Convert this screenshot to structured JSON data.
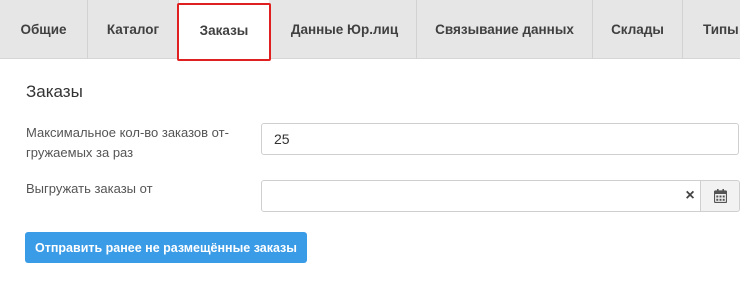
{
  "tabs": [
    {
      "label": "Общие"
    },
    {
      "label": "Каталог"
    },
    {
      "label": "Заказы",
      "active": true
    },
    {
      "label": "Данные Юр.лиц"
    },
    {
      "label": "Связывание данных"
    },
    {
      "label": "Склады"
    },
    {
      "label": "Типы"
    }
  ],
  "section": {
    "title": "Заказы"
  },
  "fields": {
    "max_orders": {
      "label": "Максимальное кол-во заказов от-гружаемых за раз",
      "value": "25"
    },
    "export_from": {
      "label": "Выгружать заказы от",
      "value": ""
    }
  },
  "icons": {
    "clear": "×",
    "calendar": "calendar-icon"
  },
  "actions": {
    "send_button": "Отправить ранее не размещённые заказы"
  },
  "colors": {
    "accent": "#3a9be6",
    "highlight": "#e02020",
    "tabbar_bg": "#e6e6e6"
  }
}
